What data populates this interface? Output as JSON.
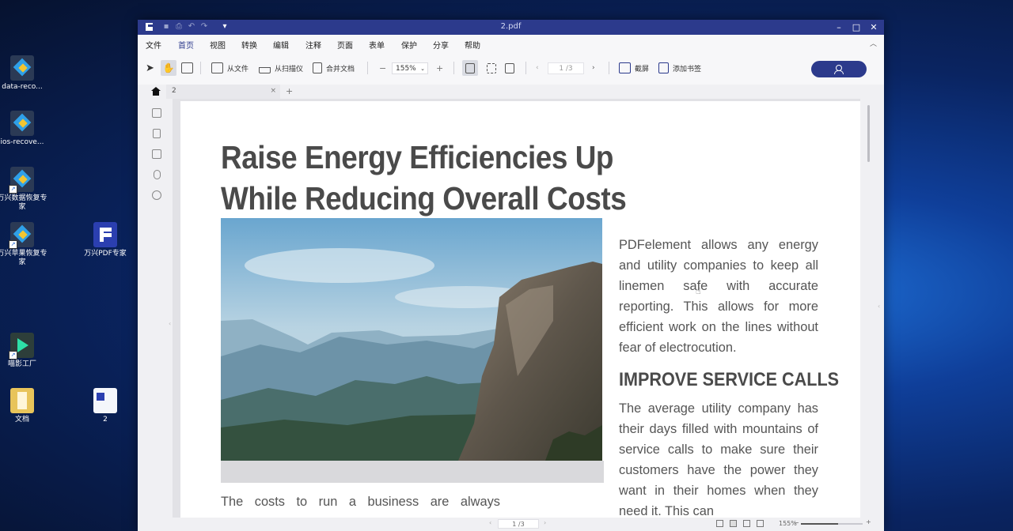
{
  "desktop": {
    "icons": [
      {
        "label": "data-reco...",
        "kind": "recovery"
      },
      {
        "label": "ios-recove...",
        "kind": "recovery"
      },
      {
        "label": "万兴数据恢复专家",
        "kind": "recovery"
      },
      {
        "label": "万兴苹果恢复专家",
        "kind": "recovery"
      },
      {
        "label": "万兴PDF专家",
        "kind": "pdf"
      },
      {
        "label": "喵影工厂",
        "kind": "film"
      },
      {
        "label": "文档",
        "kind": "folder"
      },
      {
        "label": "2",
        "kind": "document"
      }
    ]
  },
  "window": {
    "title": "2.pdf",
    "menu": [
      "文件",
      "首页",
      "视图",
      "转换",
      "编辑",
      "注释",
      "页面",
      "表单",
      "保护",
      "分享",
      "帮助"
    ],
    "active_menu": "首页",
    "toolbar": {
      "from_file": "从文件",
      "from_scanner": "从扫描仪",
      "combine": "合并文档",
      "zoom_minus": "−",
      "zoom_value": "155%",
      "zoom_plus": "+",
      "page_value": "1 /3",
      "screenshot": "截屏",
      "add_bookmark": "添加书签"
    },
    "tab": {
      "name": "2",
      "close": "×",
      "add": "+"
    }
  },
  "document": {
    "headline": "Raise Energy Efficiencies Up While Reducing Overall Costs",
    "paragraph1": "PDFelement allows any energy and utility companies to keep all linemen safe with accurate reporting. This allows for more efficient work on the lines without fear of electrocution.",
    "subheading": "IMPROVE SERVICE CALLS",
    "paragraph2": "The average utility company has their days filled with mountains of service calls to make sure their customers have the power they want in their homes when they need it. This can",
    "bottom_text": "The costs to run a business are always"
  },
  "status": {
    "page": "1 /3",
    "zoom": "155%",
    "zoom_level_fraction": 0.6
  },
  "colors": {
    "brand": "#2c3a8c",
    "heading": "#4a4a4a",
    "body": "#555555"
  }
}
